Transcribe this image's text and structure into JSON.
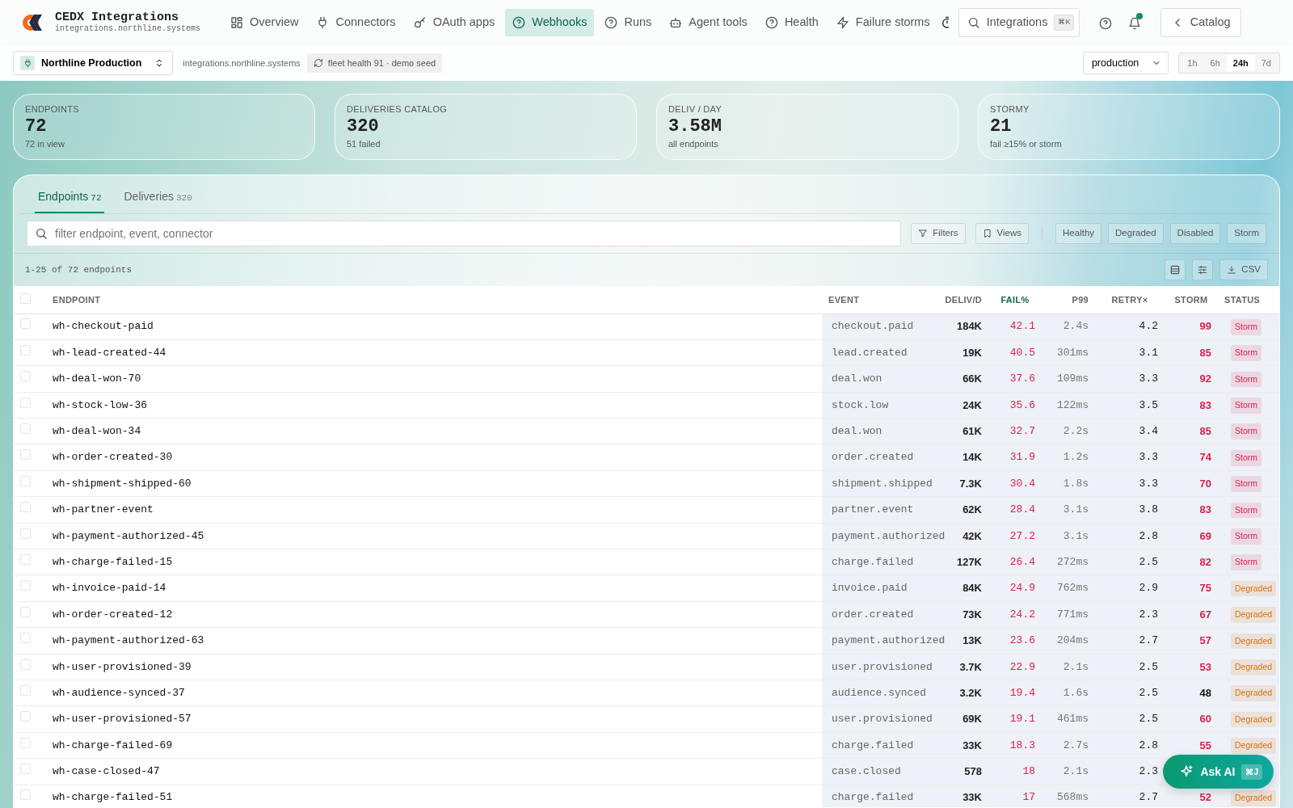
{
  "brand": {
    "title": "CEDX Integrations",
    "subtitle": "integrations.northline.systems"
  },
  "nav": [
    {
      "label": "Overview",
      "selected": false
    },
    {
      "label": "Connectors",
      "selected": false
    },
    {
      "label": "OAuth apps",
      "selected": false
    },
    {
      "label": "Webhooks",
      "selected": true
    },
    {
      "label": "Runs",
      "selected": false
    },
    {
      "label": "Agent tools",
      "selected": false
    },
    {
      "label": "Health",
      "selected": false
    },
    {
      "label": "Failure storms",
      "selected": false
    }
  ],
  "search": {
    "label": "Integrations",
    "shortcut": "⌘K"
  },
  "notifications": {
    "unread": true
  },
  "catalog_button": "Catalog",
  "workspace": {
    "name": "Northline Production",
    "host": "integrations.northline.systems",
    "health": "fleet health 91 · demo seed"
  },
  "environment": "production",
  "ranges": [
    {
      "label": "1h",
      "selected": false
    },
    {
      "label": "6h",
      "selected": false
    },
    {
      "label": "24h",
      "selected": true
    },
    {
      "label": "7d",
      "selected": false
    }
  ],
  "stats": [
    {
      "label": "ENDPOINTS",
      "value": "72",
      "note": "72 in view"
    },
    {
      "label": "DELIVERIES CATALOG",
      "value": "320",
      "note": "51 failed"
    },
    {
      "label": "DELIV / DAY",
      "value": "3.58M",
      "note": "all endpoints"
    },
    {
      "label": "STORMY",
      "value": "21",
      "note": "fail ≥15% or storm"
    }
  ],
  "tabs": [
    {
      "label": "Endpoints",
      "count": "72",
      "selected": true
    },
    {
      "label": "Deliveries",
      "count": "320",
      "selected": false
    }
  ],
  "filter": {
    "placeholder": "filter endpoint, event, connector"
  },
  "filter_buttons": [
    "Filters",
    "Views"
  ],
  "status_chips": [
    "Healthy",
    "Degraded",
    "Disabled",
    "Storm"
  ],
  "range_text": "1-25 of 72 endpoints",
  "csv_button": "CSV",
  "table": {
    "select_all": {
      "checked": false
    },
    "columns": [
      {
        "label": "ENDPOINT",
        "sorted": false
      },
      {
        "label": "EVENT",
        "sorted": false
      },
      {
        "label": "DELIV/D",
        "sorted": false
      },
      {
        "label": "FAIL%",
        "sorted": true
      },
      {
        "label": "P99",
        "sorted": false
      },
      {
        "label": "RETRY×",
        "sorted": false
      },
      {
        "label": "STORM",
        "sorted": false
      },
      {
        "label": "STATUS",
        "sorted": false
      }
    ],
    "rows": [
      {
        "checked": false,
        "endpoint": "wh-checkout-paid",
        "event": "checkout.paid",
        "deliv": "184K",
        "fail": "42.1",
        "p99": "2.4s",
        "retry": "4.2",
        "storm": "99",
        "storm_high": true,
        "status": {
          "label": "Storm",
          "color": "#d8234a"
        }
      },
      {
        "checked": false,
        "endpoint": "wh-lead-created-44",
        "event": "lead.created",
        "deliv": "19K",
        "fail": "40.5",
        "p99": "301ms",
        "retry": "3.1",
        "storm": "85",
        "storm_high": true,
        "status": {
          "label": "Storm",
          "color": "#d8234a"
        }
      },
      {
        "checked": false,
        "endpoint": "wh-deal-won-70",
        "event": "deal.won",
        "deliv": "66K",
        "fail": "37.6",
        "p99": "109ms",
        "retry": "3.3",
        "storm": "92",
        "storm_high": true,
        "status": {
          "label": "Storm",
          "color": "#d8234a"
        }
      },
      {
        "checked": false,
        "endpoint": "wh-stock-low-36",
        "event": "stock.low",
        "deliv": "24K",
        "fail": "35.6",
        "p99": "122ms",
        "retry": "3.5",
        "storm": "83",
        "storm_high": true,
        "status": {
          "label": "Storm",
          "color": "#d8234a"
        }
      },
      {
        "checked": false,
        "endpoint": "wh-deal-won-34",
        "event": "deal.won",
        "deliv": "61K",
        "fail": "32.7",
        "p99": "2.2s",
        "retry": "3.4",
        "storm": "85",
        "storm_high": true,
        "status": {
          "label": "Storm",
          "color": "#d8234a"
        }
      },
      {
        "checked": false,
        "endpoint": "wh-order-created-30",
        "event": "order.created",
        "deliv": "14K",
        "fail": "31.9",
        "p99": "1.2s",
        "retry": "3.3",
        "storm": "74",
        "storm_high": true,
        "status": {
          "label": "Storm",
          "color": "#d8234a"
        }
      },
      {
        "checked": false,
        "endpoint": "wh-shipment-shipped-60",
        "event": "shipment.shipped",
        "deliv": "7.3K",
        "fail": "30.4",
        "p99": "1.8s",
        "retry": "3.3",
        "storm": "70",
        "storm_high": true,
        "status": {
          "label": "Storm",
          "color": "#d8234a"
        }
      },
      {
        "checked": false,
        "endpoint": "wh-partner-event",
        "event": "partner.event",
        "deliv": "62K",
        "fail": "28.4",
        "p99": "3.1s",
        "retry": "3.8",
        "storm": "83",
        "storm_high": true,
        "status": {
          "label": "Storm",
          "color": "#d8234a"
        }
      },
      {
        "checked": false,
        "endpoint": "wh-payment-authorized-45",
        "event": "payment.authorized",
        "deliv": "42K",
        "fail": "27.2",
        "p99": "3.1s",
        "retry": "2.8",
        "storm": "69",
        "storm_high": true,
        "status": {
          "label": "Storm",
          "color": "#d8234a"
        }
      },
      {
        "checked": false,
        "endpoint": "wh-charge-failed-15",
        "event": "charge.failed",
        "deliv": "127K",
        "fail": "26.4",
        "p99": "272ms",
        "retry": "2.5",
        "storm": "82",
        "storm_high": true,
        "status": {
          "label": "Storm",
          "color": "#d8234a"
        }
      },
      {
        "checked": false,
        "endpoint": "wh-invoice-paid-14",
        "event": "invoice.paid",
        "deliv": "84K",
        "fail": "24.9",
        "p99": "762ms",
        "retry": "2.9",
        "storm": "75",
        "storm_high": true,
        "status": {
          "label": "Degraded",
          "color": "#d9730d"
        }
      },
      {
        "checked": false,
        "endpoint": "wh-order-created-12",
        "event": "order.created",
        "deliv": "73K",
        "fail": "24.2",
        "p99": "771ms",
        "retry": "2.3",
        "storm": "67",
        "storm_high": true,
        "status": {
          "label": "Degraded",
          "color": "#d9730d"
        }
      },
      {
        "checked": false,
        "endpoint": "wh-payment-authorized-63",
        "event": "payment.authorized",
        "deliv": "13K",
        "fail": "23.6",
        "p99": "204ms",
        "retry": "2.7",
        "storm": "57",
        "storm_high": true,
        "status": {
          "label": "Degraded",
          "color": "#d9730d"
        }
      },
      {
        "checked": false,
        "endpoint": "wh-user-provisioned-39",
        "event": "user.provisioned",
        "deliv": "3.7K",
        "fail": "22.9",
        "p99": "2.1s",
        "retry": "2.5",
        "storm": "53",
        "storm_high": true,
        "status": {
          "label": "Degraded",
          "color": "#d9730d"
        }
      },
      {
        "checked": false,
        "endpoint": "wh-audience-synced-37",
        "event": "audience.synced",
        "deliv": "3.2K",
        "fail": "19.4",
        "p99": "1.6s",
        "retry": "2.5",
        "storm": "48",
        "storm_high": false,
        "status": {
          "label": "Degraded",
          "color": "#d9730d"
        }
      },
      {
        "checked": false,
        "endpoint": "wh-user-provisioned-57",
        "event": "user.provisioned",
        "deliv": "69K",
        "fail": "19.1",
        "p99": "461ms",
        "retry": "2.5",
        "storm": "60",
        "storm_high": true,
        "status": {
          "label": "Degraded",
          "color": "#d9730d"
        }
      },
      {
        "checked": false,
        "endpoint": "wh-charge-failed-69",
        "event": "charge.failed",
        "deliv": "33K",
        "fail": "18.3",
        "p99": "2.7s",
        "retry": "2.8",
        "storm": "55",
        "storm_high": true,
        "status": {
          "label": "Degraded",
          "color": "#d9730d"
        }
      },
      {
        "checked": false,
        "endpoint": "wh-case-closed-47",
        "event": "case.closed",
        "deliv": "578",
        "fail": "18",
        "p99": "2.1s",
        "retry": "2.3"
      },
      {
        "checked": false,
        "endpoint": "wh-charge-failed-51",
        "event": "charge.failed",
        "deliv": "33K",
        "fail": "17",
        "p99": "568ms",
        "retry": "2.7",
        "storm": "52",
        "storm_high": true,
        "status": {
          "label": "Degraded",
          "color": "#d9730d"
        }
      }
    ]
  },
  "ask_ai": {
    "label": "Ask AI",
    "shortcut": "⌘J"
  }
}
